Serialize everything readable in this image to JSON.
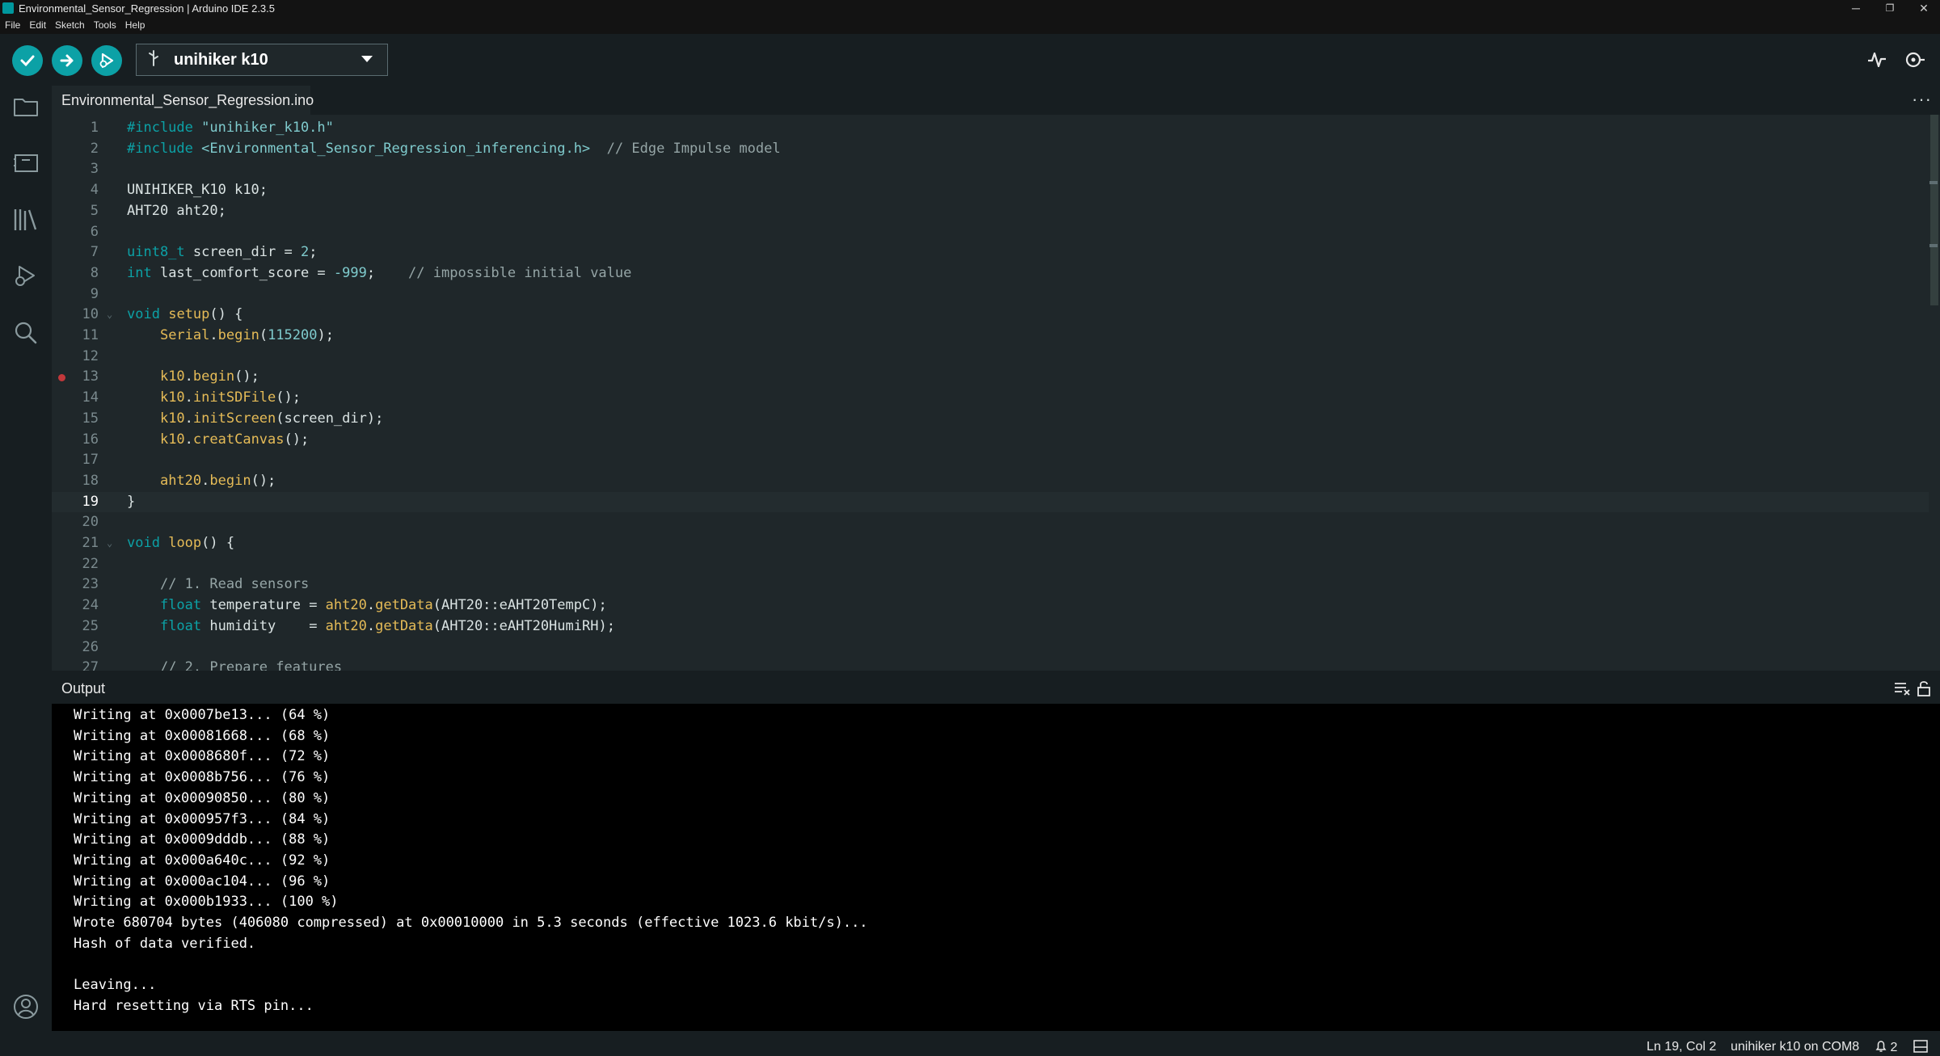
{
  "window": {
    "title": "Environmental_Sensor_Regression | Arduino IDE 2.3.5",
    "minimize": "─",
    "restore": "❐",
    "close": "✕"
  },
  "menu": [
    "File",
    "Edit",
    "Sketch",
    "Tools",
    "Help"
  ],
  "toolbar": {
    "verify_icon": "checkmark-icon",
    "upload_icon": "arrow-right-icon",
    "debug_icon": "debug-icon",
    "board": "unihiker k10",
    "serial_plotter_icon": "serial-plotter-icon",
    "serial_monitor_icon": "serial-monitor-icon"
  },
  "sidebar": [
    "sketchbook-icon",
    "boards-manager-icon",
    "library-manager-icon",
    "debug-icon",
    "search-icon",
    "account-icon"
  ],
  "tab": {
    "filename": "Environmental_Sensor_Regression.ino",
    "more": "···"
  },
  "editor": {
    "current_line": 19,
    "breakpoint_line": 13,
    "lines": [
      [
        [
          "pre",
          "#include "
        ],
        [
          "str",
          "\"unihiker_k10.h\""
        ]
      ],
      [
        [
          "pre",
          "#include "
        ],
        [
          "str",
          "<Environmental_Sensor_Regression_inferencing.h>"
        ],
        [
          "txt",
          "  "
        ],
        [
          "cmt",
          "// Edge Impulse model"
        ]
      ],
      [],
      [
        [
          "txt",
          "UNIHIKER_K10 k10;"
        ]
      ],
      [
        [
          "txt",
          "AHT20 aht20;"
        ]
      ],
      [],
      [
        [
          "type",
          "uint8_t"
        ],
        [
          "txt",
          " screen_dir = "
        ],
        [
          "num",
          "2"
        ],
        [
          "txt",
          ";"
        ]
      ],
      [
        [
          "type",
          "int"
        ],
        [
          "txt",
          " last_comfort_score = "
        ],
        [
          "num",
          "-999"
        ],
        [
          "txt",
          ";    "
        ],
        [
          "cmt",
          "// impossible initial value"
        ]
      ],
      [],
      [
        [
          "kw",
          "void"
        ],
        [
          "txt",
          " "
        ],
        [
          "fn",
          "setup"
        ],
        [
          "txt",
          "() {"
        ]
      ],
      [
        [
          "txt",
          "    "
        ],
        [
          "fn",
          "Serial"
        ],
        [
          "txt",
          "."
        ],
        [
          "fn",
          "begin"
        ],
        [
          "txt",
          "("
        ],
        [
          "num",
          "115200"
        ],
        [
          "txt",
          ");"
        ]
      ],
      [],
      [
        [
          "txt",
          "    "
        ],
        [
          "fn",
          "k10"
        ],
        [
          "txt",
          "."
        ],
        [
          "fn",
          "begin"
        ],
        [
          "txt",
          "();"
        ]
      ],
      [
        [
          "txt",
          "    "
        ],
        [
          "fn",
          "k10"
        ],
        [
          "txt",
          "."
        ],
        [
          "fn",
          "initSDFile"
        ],
        [
          "txt",
          "();"
        ]
      ],
      [
        [
          "txt",
          "    "
        ],
        [
          "fn",
          "k10"
        ],
        [
          "txt",
          "."
        ],
        [
          "fn",
          "initScreen"
        ],
        [
          "txt",
          "(screen_dir);"
        ]
      ],
      [
        [
          "txt",
          "    "
        ],
        [
          "fn",
          "k10"
        ],
        [
          "txt",
          "."
        ],
        [
          "fn",
          "creatCanvas"
        ],
        [
          "txt",
          "();"
        ]
      ],
      [],
      [
        [
          "txt",
          "    "
        ],
        [
          "fn",
          "aht20"
        ],
        [
          "txt",
          "."
        ],
        [
          "fn",
          "begin"
        ],
        [
          "txt",
          "();"
        ]
      ],
      [
        [
          "txt",
          "}"
        ]
      ],
      [],
      [
        [
          "kw",
          "void"
        ],
        [
          "txt",
          " "
        ],
        [
          "fn",
          "loop"
        ],
        [
          "txt",
          "() {"
        ]
      ],
      [],
      [
        [
          "txt",
          "    "
        ],
        [
          "cmt",
          "// 1. Read sensors"
        ]
      ],
      [
        [
          "txt",
          "    "
        ],
        [
          "type",
          "float"
        ],
        [
          "txt",
          " temperature = "
        ],
        [
          "fn",
          "aht20"
        ],
        [
          "txt",
          "."
        ],
        [
          "fn",
          "getData"
        ],
        [
          "txt",
          "(AHT20::eAHT20TempC);"
        ]
      ],
      [
        [
          "txt",
          "    "
        ],
        [
          "type",
          "float"
        ],
        [
          "txt",
          " humidity    = "
        ],
        [
          "fn",
          "aht20"
        ],
        [
          "txt",
          "."
        ],
        [
          "fn",
          "getData"
        ],
        [
          "txt",
          "(AHT20::eAHT20HumiRH);"
        ]
      ],
      [],
      [
        [
          "txt",
          "    "
        ],
        [
          "cmt",
          "// 2. Prepare features"
        ]
      ]
    ]
  },
  "output": {
    "label": "Output",
    "clear_icon": "clear-output-icon",
    "lock_icon": "scroll-lock-icon",
    "lines": [
      "Writing at 0x0007be13... (64 %)",
      "Writing at 0x00081668... (68 %)",
      "Writing at 0x0008680f... (72 %)",
      "Writing at 0x0008b756... (76 %)",
      "Writing at 0x00090850... (80 %)",
      "Writing at 0x000957f3... (84 %)",
      "Writing at 0x0009dddb... (88 %)",
      "Writing at 0x000a640c... (92 %)",
      "Writing at 0x000ac104... (96 %)",
      "Writing at 0x000b1933... (100 %)",
      "Wrote 680704 bytes (406080 compressed) at 0x00010000 in 5.3 seconds (effective 1023.6 kbit/s)...",
      "Hash of data verified.",
      "",
      "Leaving...",
      "Hard resetting via RTS pin..."
    ]
  },
  "status": {
    "position": "Ln 19, Col 2",
    "board_port": "unihiker k10 on COM8",
    "notifications": "2"
  }
}
